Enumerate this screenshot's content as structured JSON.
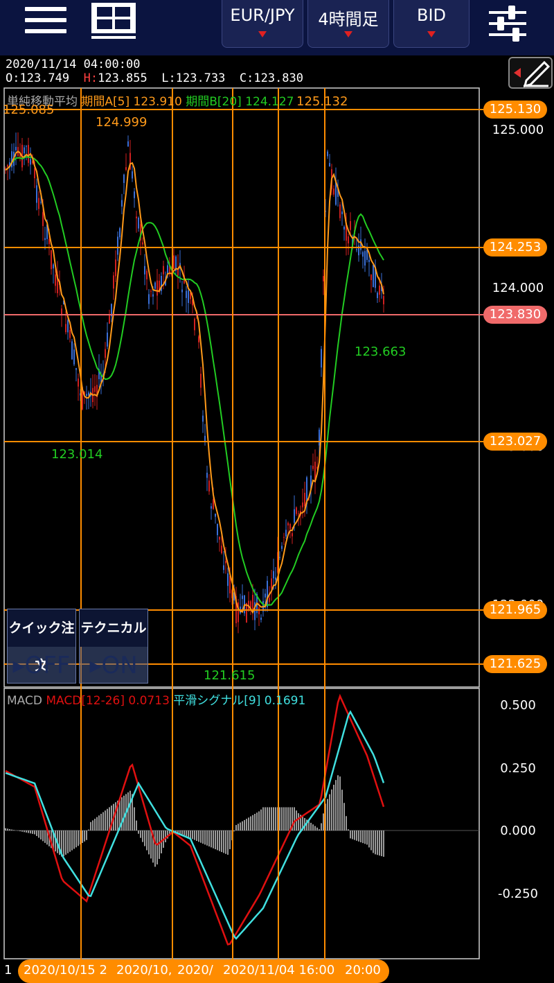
{
  "toolbar": {
    "pair": "EUR/JPY",
    "timeframe": "4時間足",
    "price_type": "BID"
  },
  "ohlc": {
    "datetime": "2020/11/14 04:00:00",
    "o_label": "O:",
    "o": "123.749",
    "h_label": "H:",
    "h": "123.855",
    "l_label": "L:",
    "l": "123.733",
    "c_label": "C:",
    "c": "123.830"
  },
  "price_legend": {
    "name": "単純移動平均",
    "a": "期間A[5] 123.910",
    "b": "期間B[20] 124.127"
  },
  "macd_legend": {
    "name": "MACD",
    "macd": "MACD[12-26] 0.0713",
    "signal": "平滑シグナル[9] 0.1691"
  },
  "price_axis": [
    "125.000",
    "124.000",
    "123.000",
    "122.000"
  ],
  "macd_axis": [
    "0.500",
    "0.250",
    "0.000",
    "-0.250"
  ],
  "price_tags": [
    "125.130",
    "124.253",
    "123.830",
    "123.027",
    "121.965",
    "121.625"
  ],
  "annotations": {
    "max_left": "125.085",
    "max_mid": "124.999",
    "max_right": "125.132",
    "min_left": "123.014",
    "min_mid": "121.615",
    "min_right": "123.663"
  },
  "quick_order": {
    "title": "クイック注文",
    "state": "OFF"
  },
  "technical": {
    "title": "テクニカル",
    "state": "ON"
  },
  "dates": [
    "2020/10/15 2",
    "2020/10,",
    "2020/",
    "2020/11/04 16:00",
    "20:00"
  ],
  "left_cut": "1",
  "colors": {
    "topbar": "#0b1440",
    "line_orange": "#ff8c00",
    "ma_a": "#ff9a1a",
    "ma_b": "#22cc22",
    "macd": "#e01010",
    "signal": "#40e0e0",
    "candle_up": "#3a6fd8",
    "candle_down": "#d02020",
    "current": "#f06a6a"
  },
  "icons": [
    "hamburger-menu-icon",
    "layout-grid-icon",
    "sliders-icon",
    "pen-icon"
  ]
}
